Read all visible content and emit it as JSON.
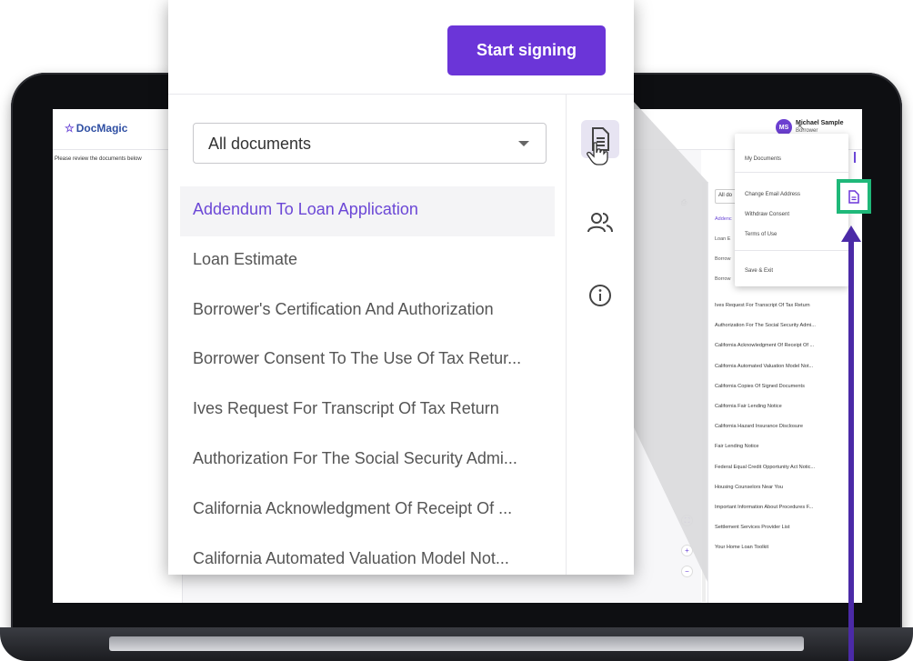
{
  "app": {
    "logo": "DocMagic",
    "review_text": "Please review the documents below"
  },
  "user": {
    "initials": "MS",
    "name": "Michael Sample",
    "role": "Borrower"
  },
  "menu": {
    "items": [
      {
        "label": "My Documents"
      },
      {
        "label": "Change Email Address"
      },
      {
        "label": "Withdraw Consent"
      },
      {
        "label": "Terms of Use"
      },
      {
        "label": "Save & Exit"
      }
    ]
  },
  "small_panel": {
    "select_value": "All do",
    "partial_items": [
      "Addenc",
      "Loan E",
      "Borrow",
      "Borrow"
    ],
    "items": [
      "Ives Request For Transcript Of Tax Return",
      "Authorization For The Social Security Admi...",
      "California Acknowledgment Of Receipt Of ...",
      "California Automated Valuation Model Not...",
      "California Copies Of Signed Documents",
      "California Fair Lending Notice",
      "California Hazard Insurance Disclosure",
      "Fair Lending Notice",
      "Federal Equal Credit Opportunity Act Notic...",
      "Housing Counselors Near You",
      "Important Information About Procedures F...",
      "Settlement Services Provider List",
      "Your Home Loan Toolkit"
    ]
  },
  "magnifier": {
    "start_button": "Start signing",
    "select_value": "All documents",
    "documents": [
      {
        "label": "Addendum To Loan Application",
        "active": true
      },
      {
        "label": "Loan Estimate",
        "active": false
      },
      {
        "label": "Borrower's Certification And Authorization",
        "active": false
      },
      {
        "label": "Borrower Consent To The Use Of Tax Retur...",
        "active": false
      },
      {
        "label": "Ives Request For Transcript Of Tax Return",
        "active": false
      },
      {
        "label": "Authorization For The Social Security Admi...",
        "active": false
      },
      {
        "label": "California Acknowledgment Of Receipt Of ...",
        "active": false
      },
      {
        "label": "California Automated Valuation Model Not...",
        "active": false
      }
    ],
    "side_icons": [
      "document-icon",
      "people-icon",
      "info-icon"
    ]
  },
  "colors": {
    "accent": "#6b35d8",
    "highlight": "#1fb879",
    "arrow": "#4b2aa7"
  }
}
